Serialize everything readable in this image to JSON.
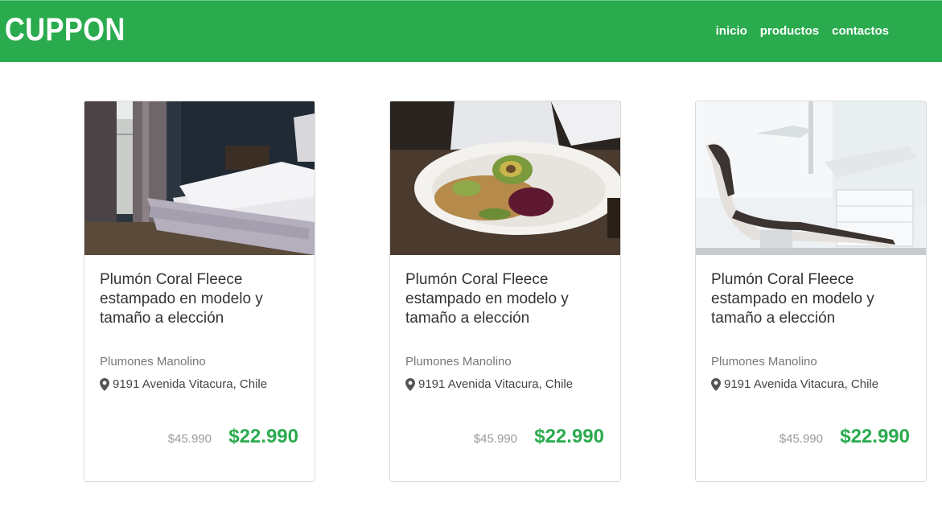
{
  "header": {
    "brand": "CUPPON",
    "nav": [
      {
        "label": "inicio"
      },
      {
        "label": "productos"
      },
      {
        "label": "contactos"
      }
    ]
  },
  "colors": {
    "brand_green": "#2aab4e",
    "price_green": "#2aab4e"
  },
  "products": [
    {
      "image": "bedroom-bed-photo",
      "title": "Plumón Coral Fleece estampado en modelo y tamaño a elección",
      "vendor": "Plumones Manolino",
      "location_icon": "map-marker-icon",
      "address": "9191 Avenida Vitacura, Chile",
      "old_price": "$45.990",
      "price": "$22.990"
    },
    {
      "image": "salad-plate-photo",
      "title": "Plumón Coral Fleece estampado en modelo y tamaño a elección",
      "vendor": "Plumones Manolino",
      "location_icon": "map-marker-icon",
      "address": "9191 Avenida Vitacura, Chile",
      "old_price": "$45.990",
      "price": "$22.990"
    },
    {
      "image": "dental-chair-photo",
      "title": "Plumón Coral Fleece estampado en modelo y tamaño a elección",
      "vendor": "Plumones Manolino",
      "location_icon": "map-marker-icon",
      "address": "9191 Avenida Vitacura, Chile",
      "old_price": "$45.990",
      "price": "$22.990"
    }
  ]
}
